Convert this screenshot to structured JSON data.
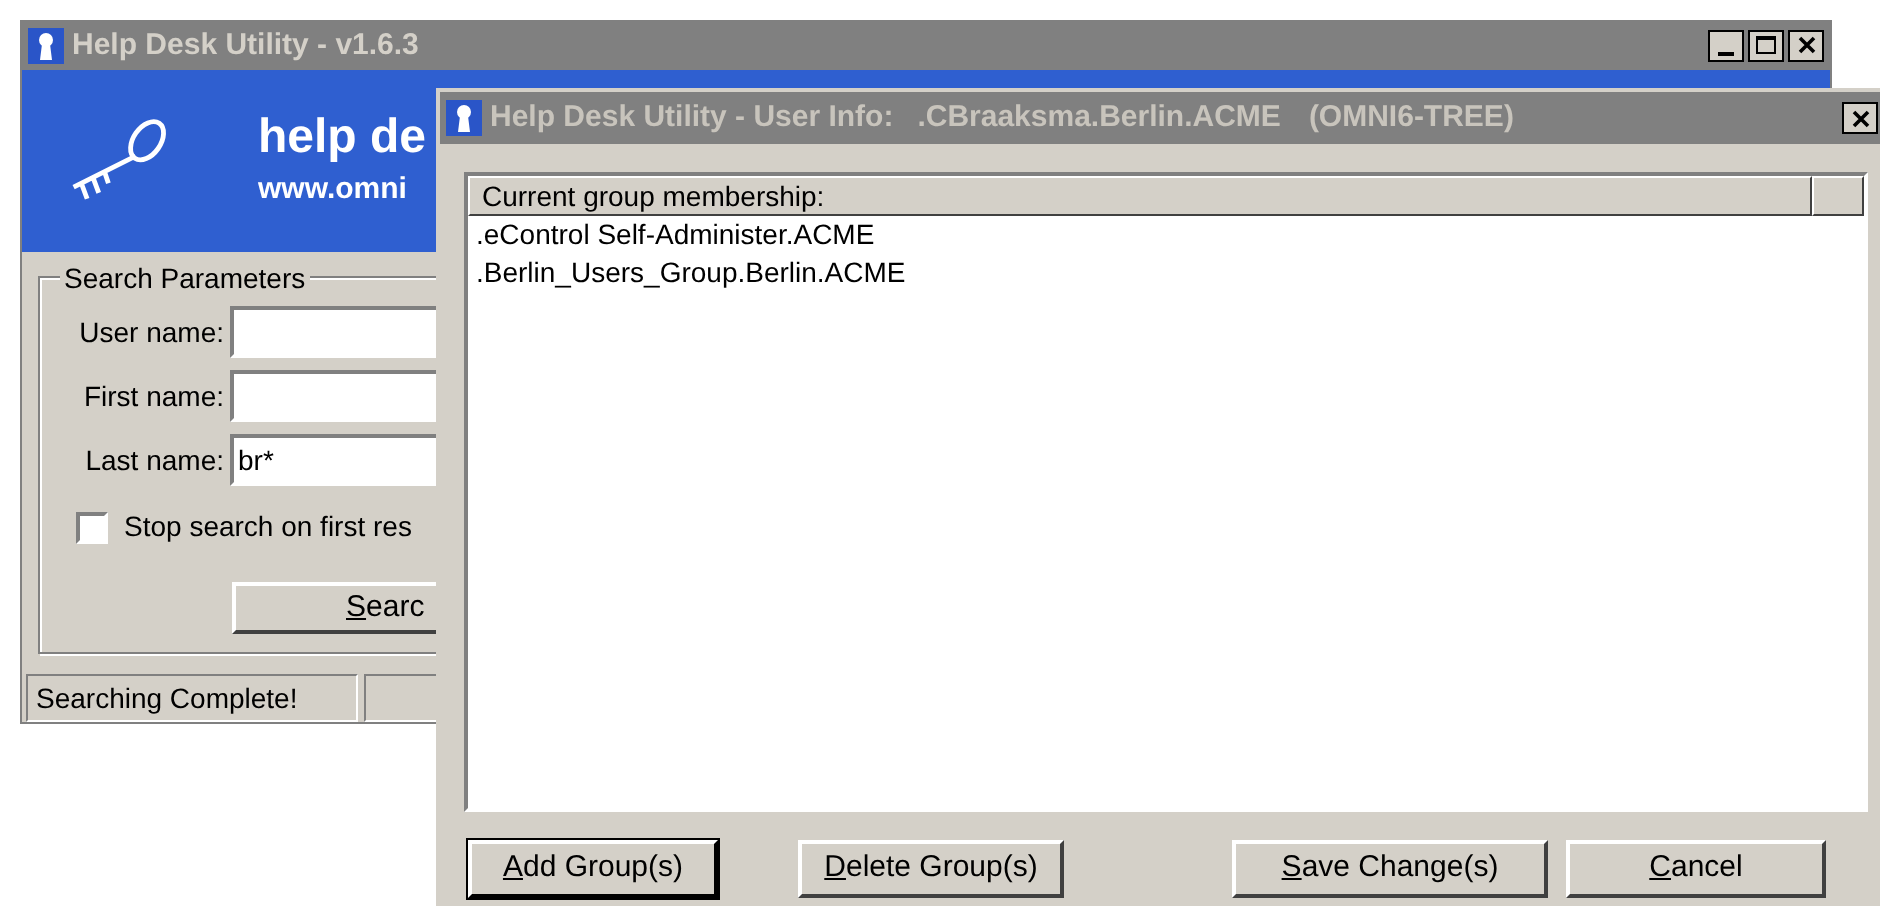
{
  "main_window": {
    "title": "Help Desk Utility - v1.6.3",
    "banner": {
      "heading": "help de",
      "url": "www.omni"
    },
    "search_parameters": {
      "legend": "Search Parameters",
      "fields": [
        {
          "label": "User name:"
        },
        {
          "label": "First name:"
        },
        {
          "label": "Last name:",
          "value": "br*"
        }
      ],
      "stop_checkbox": {
        "label": "Stop search on first res",
        "checked": false
      },
      "search_button": {
        "accel": "S",
        "label": "earc"
      }
    },
    "status_bar": [
      "Searching Complete!"
    ]
  },
  "dialog": {
    "title": "Help Desk Utility - User Info:",
    "user": ".CBraaksma.Berlin.ACME",
    "tree": "(OMNI6-TREE)",
    "list": {
      "column": "Current group membership:",
      "rows": [
        ".eControl Self-Administer.ACME",
        ".Berlin_Users_Group.Berlin.ACME"
      ]
    },
    "buttons": [
      {
        "accel": "A",
        "label": "dd Group(s)",
        "default": true
      },
      {
        "accel": "D",
        "label": "elete Group(s)",
        "default": false
      },
      {
        "accel": "S",
        "label": "ave Change(s)",
        "default": false
      },
      {
        "accel": "C",
        "label": "ancel",
        "default": false
      }
    ]
  }
}
